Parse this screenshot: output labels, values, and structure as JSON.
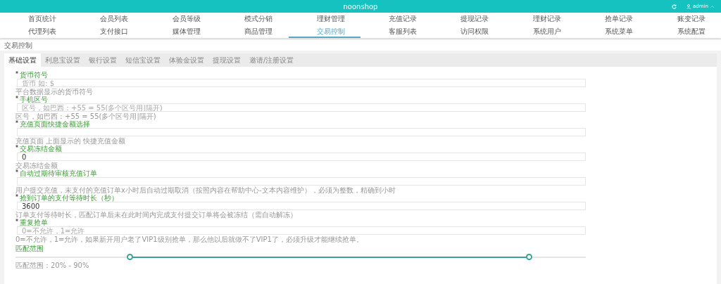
{
  "header": {
    "title": "noonshop",
    "user": "admin"
  },
  "nav": [
    {
      "label": "首页统计",
      "selected": false
    },
    {
      "label": "会员列表",
      "selected": false
    },
    {
      "label": "会员等级",
      "selected": false
    },
    {
      "label": "模式分销",
      "selected": false
    },
    {
      "label": "理财管理",
      "selected": false
    },
    {
      "label": "充值记录",
      "selected": false
    },
    {
      "label": "提现记录",
      "selected": false
    },
    {
      "label": "理财记录",
      "selected": false
    },
    {
      "label": "抢单记录",
      "selected": false
    },
    {
      "label": "账变记录",
      "selected": false
    },
    {
      "label": "代理列表",
      "selected": false
    },
    {
      "label": "支付接口",
      "selected": false
    },
    {
      "label": "媒体管理",
      "selected": false
    },
    {
      "label": "商品管理",
      "selected": false
    },
    {
      "label": "交易控制",
      "selected": true
    },
    {
      "label": "客服列表",
      "selected": false
    },
    {
      "label": "访问权限",
      "selected": false
    },
    {
      "label": "系统用户",
      "selected": false
    },
    {
      "label": "系统菜单",
      "selected": false
    },
    {
      "label": "系统配置",
      "selected": false
    }
  ],
  "breadcrumb": "交易控制",
  "tabs": [
    {
      "label": "基础设置",
      "selected": true
    },
    {
      "label": "利息宝设置",
      "selected": false
    },
    {
      "label": "银行设置",
      "selected": false
    },
    {
      "label": "短信宝设置",
      "selected": false
    },
    {
      "label": "体验金设置",
      "selected": false
    },
    {
      "label": "提现设置",
      "selected": false
    },
    {
      "label": "邀请/注册设置",
      "selected": false
    }
  ],
  "fields": [
    {
      "kind": "input",
      "label": "货币符号",
      "required": true,
      "placeholder": "货币 如: $",
      "help": "平台数据显示的货币符号"
    },
    {
      "kind": "input",
      "label": "手机区号",
      "required": true,
      "placeholder": "区号，如巴西：+55 = 55(多个区号用|隔开)",
      "help": "区号，如巴西：+55 = 55(多个区号用|隔开)"
    },
    {
      "kind": "input",
      "label": "充值页面快捷金额选择",
      "required": true,
      "help": "充值页面 上面显示的 快捷充值金额"
    },
    {
      "kind": "input",
      "label": "交易冻结金额",
      "required": true,
      "value": "0",
      "help": "交易冻结金额"
    },
    {
      "kind": "input",
      "label": "自动过期待审核充值订单",
      "required": true,
      "help": "用户提交充值，未支付的充值订单x小时后自动过期取消（按照内容在帮助中心-文本内容维护），必须为整数，精确到小时"
    },
    {
      "kind": "input",
      "label": "抢到订单的支付等待时长（秒）",
      "required": true,
      "value": "3600",
      "help": "订单支付等待时长，匹配订单后未在此时间内完成支付提交订单将会被冻结（需自动解冻）"
    },
    {
      "kind": "input",
      "label": "重复抢单",
      "required": true,
      "placeholder": "0=不允许，1=允许",
      "help": "0=不允许，1=允许，如果新开用户老了VIP1级别抢单，那么他以后就做不了VIP1了，必须升级才能继续抢单。"
    },
    {
      "kind": "range",
      "label": "匹配范围",
      "required": false,
      "thumbs": [
        {
          "level": 0.2
        },
        {
          "level": 0.9
        }
      ],
      "help": "匹配范围：20% - 90%"
    }
  ]
}
